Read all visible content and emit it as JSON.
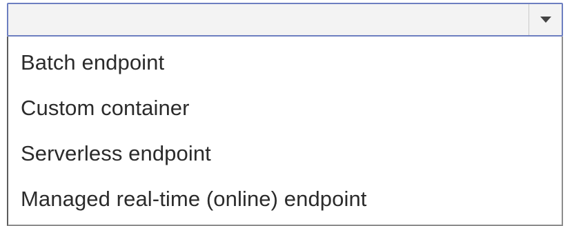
{
  "dropdown": {
    "selected_value": "",
    "arrow_icon": "chevron-down-icon",
    "options": [
      {
        "label": "Batch endpoint"
      },
      {
        "label": "Custom container"
      },
      {
        "label": "Serverless endpoint"
      },
      {
        "label": "Managed real-time (online) endpoint"
      }
    ]
  },
  "colors": {
    "focus_border": "#6c7ec0",
    "select_background": "#f3f3f3",
    "text": "#2b2b2b"
  }
}
